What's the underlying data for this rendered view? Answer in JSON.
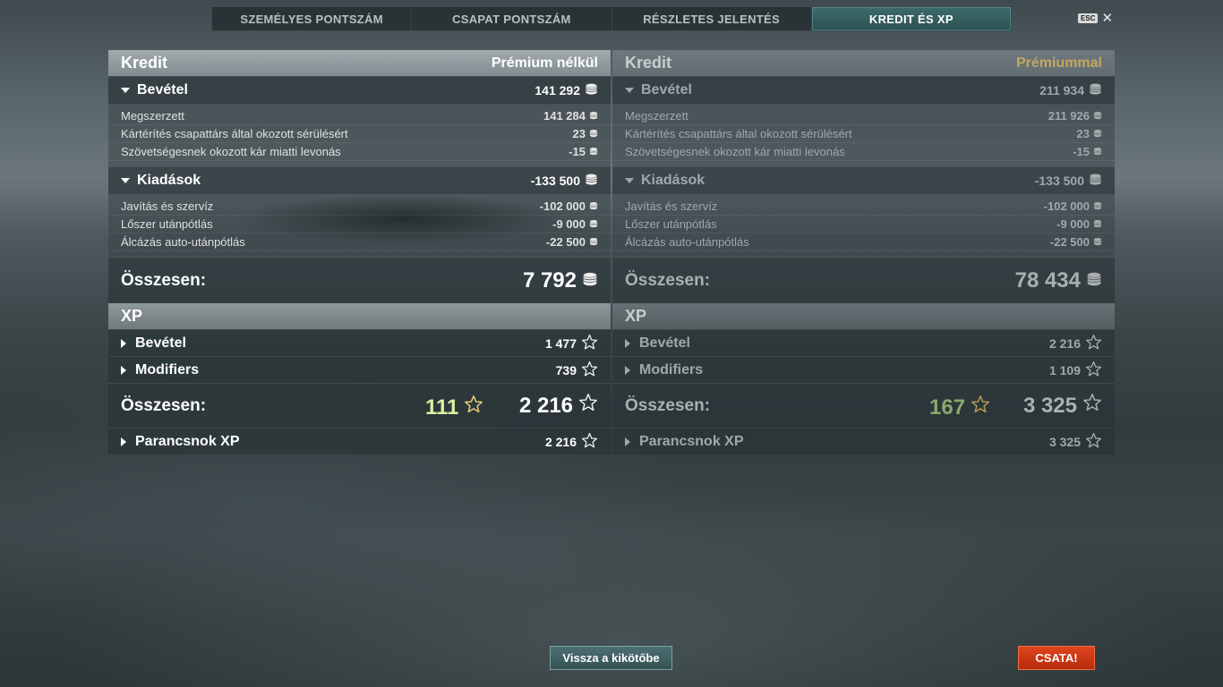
{
  "tabs": [
    {
      "label": "SZEMÉLYES PONTSZÁM",
      "active": false
    },
    {
      "label": "CSAPAT PONTSZÁM",
      "active": false
    },
    {
      "label": "RÉSZLETES JELENTÉS",
      "active": false
    },
    {
      "label": "KREDIT ÉS XP",
      "active": true
    }
  ],
  "esc": {
    "badge": "ESC",
    "close": "✕"
  },
  "left": {
    "credit_title": "Kredit",
    "credit_subtitle": "Prémium nélkül",
    "income": {
      "label": "Bevétel",
      "value": "141 292",
      "items": [
        {
          "label": "Megszerzett",
          "value": "141 284"
        },
        {
          "label": "Kártérítés csapattárs által okozott sérülésért",
          "value": "23"
        },
        {
          "label": "Szövetségesnek okozott kár miatti levonás",
          "value": "-15"
        }
      ]
    },
    "expenses": {
      "label": "Kiadások",
      "value": "-133 500",
      "items": [
        {
          "label": "Javítás és szervíz",
          "value": "-102 000"
        },
        {
          "label": "Lőszer utánpótlás",
          "value": "-9 000"
        },
        {
          "label": "Álcázás auto-utánpótlás",
          "value": "-22 500"
        }
      ]
    },
    "total_label": "Összesen:",
    "total_value": "7 792",
    "xp_title": "XP",
    "xp_income": {
      "label": "Bevétel",
      "value": "1 477"
    },
    "xp_modifiers": {
      "label": "Modifiers",
      "value": "739"
    },
    "xp_total_label": "Összesen:",
    "xp_bonus": "111",
    "xp_total": "2 216",
    "commander": {
      "label": "Parancsnok XP",
      "value": "2 216"
    }
  },
  "right": {
    "credit_title": "Kredit",
    "credit_subtitle": "Prémiummal",
    "income": {
      "label": "Bevétel",
      "value": "211 934",
      "items": [
        {
          "label": "Megszerzett",
          "value": "211 926"
        },
        {
          "label": "Kártérítés csapattárs által okozott sérülésért",
          "value": "23"
        },
        {
          "label": "Szövetségesnek okozott kár miatti levonás",
          "value": "-15"
        }
      ]
    },
    "expenses": {
      "label": "Kiadások",
      "value": "-133 500",
      "items": [
        {
          "label": "Javítás és szervíz",
          "value": "-102 000"
        },
        {
          "label": "Lőszer utánpótlás",
          "value": "-9 000"
        },
        {
          "label": "Álcázás auto-utánpótlás",
          "value": "-22 500"
        }
      ]
    },
    "total_label": "Összesen:",
    "total_value": "78 434",
    "xp_title": "XP",
    "xp_income": {
      "label": "Bevétel",
      "value": "2 216"
    },
    "xp_modifiers": {
      "label": "Modifiers",
      "value": "1 109"
    },
    "xp_total_label": "Összesen:",
    "xp_bonus": "167",
    "xp_total": "3 325",
    "commander": {
      "label": "Parancsnok XP",
      "value": "3 325"
    }
  },
  "buttons": {
    "back": "Vissza a kikötőbe",
    "battle": "CSATA!"
  },
  "icons": {
    "credit": "credit-coin-icon",
    "xp": "xp-star-icon",
    "bonus_star": "bonus-star-icon"
  },
  "colors": {
    "active_tab": "#2c5152",
    "premium_label": "#c6a662",
    "bonus_xp": "#d8f2a0",
    "battle_button": "#c8340f"
  }
}
